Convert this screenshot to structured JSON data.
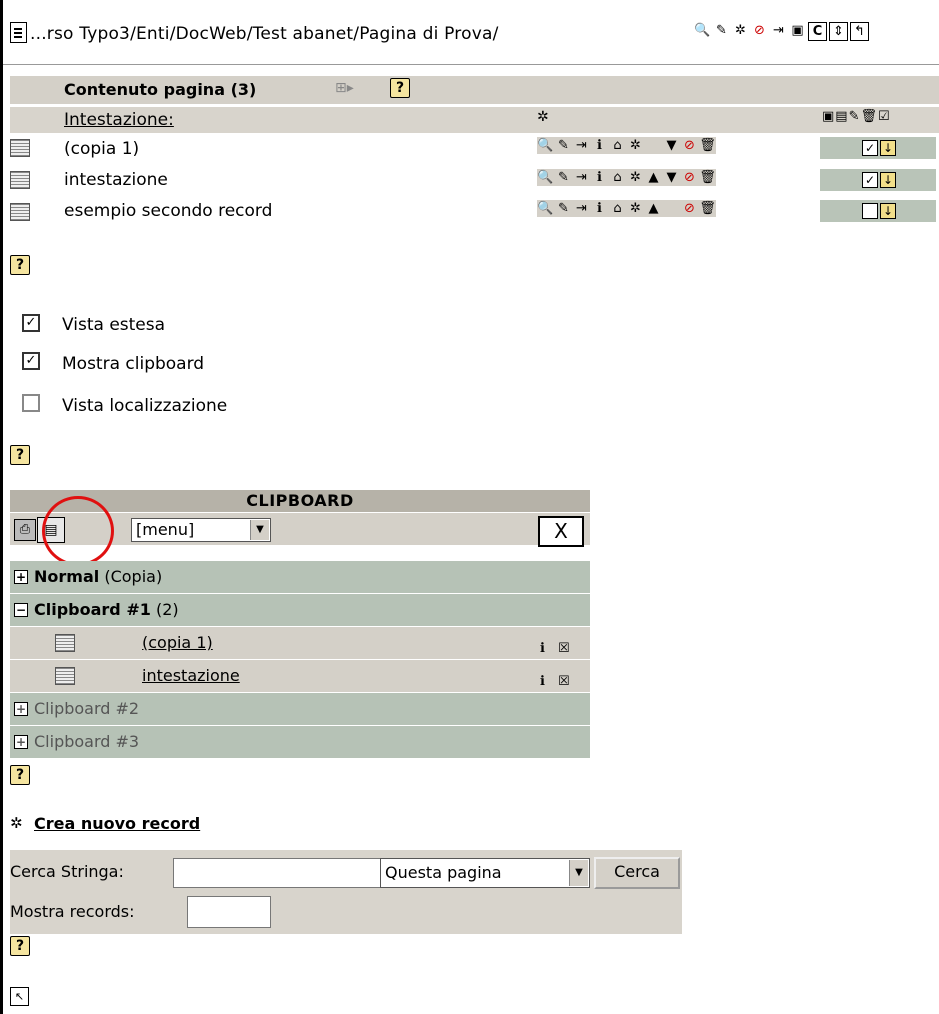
{
  "header": {
    "path": "...rso Typo3/Enti/DocWeb/Test abanet/Pagina di Prova/",
    "toolbar_icons": [
      "search-icon",
      "edit-icon",
      "new-record-icon",
      "hide-icon",
      "move-icon",
      "clipboard-icon",
      "clear-cache-icon",
      "refresh-icon",
      "up-icon"
    ]
  },
  "content": {
    "title": "Contenuto pagina (3)",
    "column_label": "Intestazione:",
    "rows": [
      {
        "label": "(copia 1)",
        "checked": true
      },
      {
        "label": "intestazione",
        "checked": true
      },
      {
        "label": "esempio secondo record",
        "checked": false
      }
    ]
  },
  "options": [
    {
      "label": "Vista estesa",
      "checked": true
    },
    {
      "label": "Mostra clipboard",
      "checked": true
    },
    {
      "label": "Vista localizzazione",
      "checked": false
    }
  ],
  "clipboard": {
    "title": "CLIPBOARD",
    "menu_value": "[menu]",
    "close_label": "X",
    "groups": [
      {
        "name": "Normal",
        "detail": "(Copia)",
        "expanded": false,
        "bold": true
      },
      {
        "name": "Clipboard #1",
        "detail": "(2)",
        "expanded": true,
        "bold": true
      },
      {
        "name": "Clipboard #2",
        "detail": "",
        "expanded": false,
        "bold": false
      },
      {
        "name": "Clipboard #3",
        "detail": "",
        "expanded": false,
        "bold": false
      }
    ],
    "items": [
      {
        "label": " (copia 1)"
      },
      {
        "label": "intestazione"
      }
    ]
  },
  "new_record": {
    "label": "Crea nuovo record"
  },
  "search": {
    "search_label": "Cerca Stringa:",
    "search_value": "",
    "scope_value": "Questa pagina",
    "button_label": "Cerca",
    "show_label": "Mostra records:",
    "show_value": ""
  },
  "colors": {
    "accent": "#e01010",
    "panel": "#d4d0c8",
    "group": "#b6c2b6"
  }
}
